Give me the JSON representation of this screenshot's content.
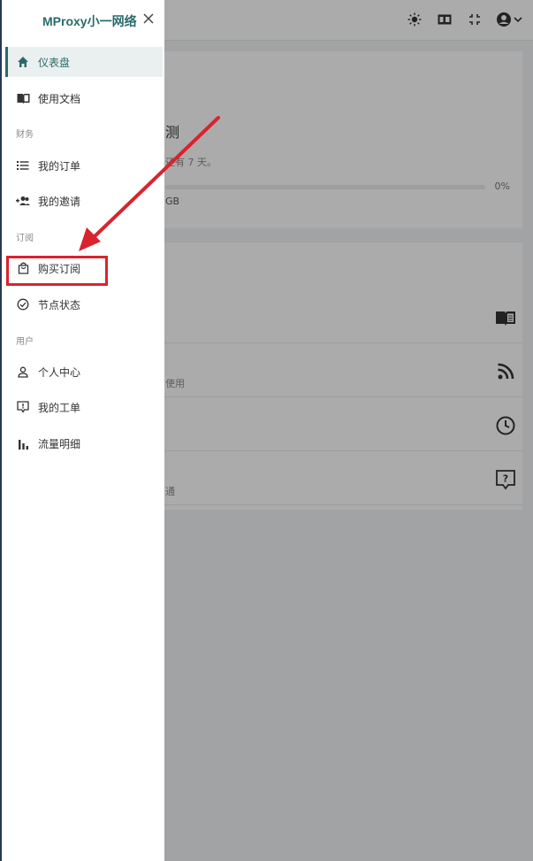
{
  "app": {
    "brand": "MProxy小一网络",
    "close_icon": "close-icon"
  },
  "topbar": {
    "icons": [
      "theme-sun-icon",
      "translate-icon",
      "fullscreen-icon",
      "account-icon",
      "chevron-down-icon"
    ]
  },
  "sidebar": {
    "items": [
      {
        "label": "仪表盘",
        "icon": "home-icon",
        "active": true
      },
      {
        "label": "使用文档",
        "icon": "book-icon"
      },
      {
        "label": "我的订单",
        "icon": "list-icon"
      },
      {
        "label": "我的邀请",
        "icon": "invite-icon"
      },
      {
        "label": "购买订阅",
        "icon": "shopping-bag-icon"
      },
      {
        "label": "节点状态",
        "icon": "check-circle-icon"
      },
      {
        "label": "个人中心",
        "icon": "user-icon"
      },
      {
        "label": "我的工单",
        "icon": "ticket-icon"
      },
      {
        "label": "流量明细",
        "icon": "bar-chart-icon"
      }
    ],
    "sections": {
      "finance": "财务",
      "subscription": "订阅",
      "user": "用户"
    }
  },
  "main": {
    "plan_title": "测",
    "plan_subtitle": "还有 7 天。",
    "usage_unit": "GB",
    "usage_percent_label": "0%",
    "usage_fraction": 0,
    "rows": [
      {
        "sub": "",
        "icon": "book-open-icon"
      },
      {
        "sub": "使用",
        "icon": "rss-icon"
      },
      {
        "sub": "",
        "icon": "clock-icon"
      },
      {
        "sub": "通",
        "icon": "help-chat-icon"
      }
    ]
  },
  "annotation": {
    "arrow_color": "#d9232e",
    "highlight_color": "#d9232e"
  }
}
